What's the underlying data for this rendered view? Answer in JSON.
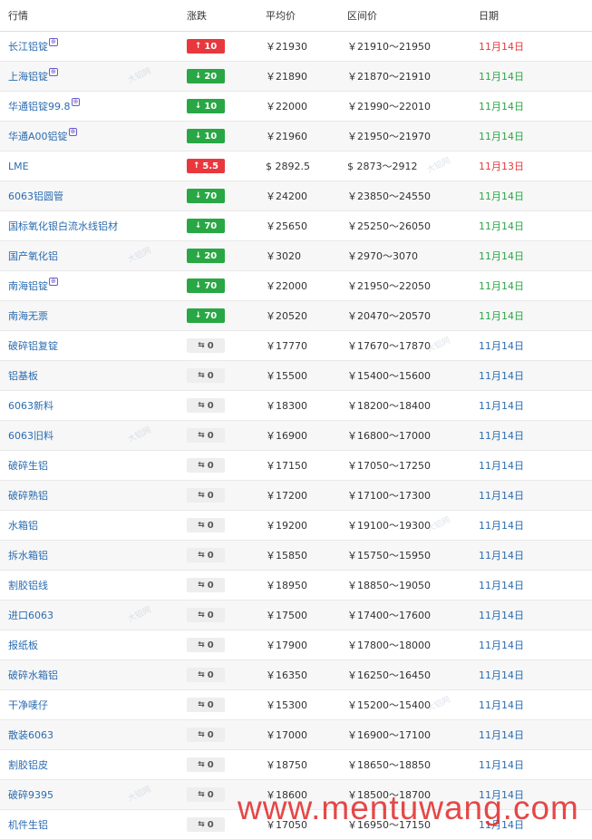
{
  "header": {
    "name": "行情",
    "change": "涨跌",
    "avg": "平均价",
    "range": "区间价",
    "date": "日期"
  },
  "rows": [
    {
      "name": "长江铝锭",
      "sup": "⊕",
      "dir": "up",
      "arrow": "↑",
      "change": "10",
      "avg": "￥21930",
      "range": "￥21910～21950",
      "date": "11月14日",
      "date_color": "red"
    },
    {
      "name": "上海铝锭",
      "sup": "⊕",
      "dir": "down",
      "arrow": "↓",
      "change": "20",
      "avg": "￥21890",
      "range": "￥21870～21910",
      "date": "11月14日",
      "date_color": "green"
    },
    {
      "name": "华通铝锭99.8",
      "sup": "⊕",
      "dir": "down",
      "arrow": "↓",
      "change": "10",
      "avg": "￥22000",
      "range": "￥21990～22010",
      "date": "11月14日",
      "date_color": "green"
    },
    {
      "name": "华通A00铝锭",
      "sup": "⊕",
      "dir": "down",
      "arrow": "↓",
      "change": "10",
      "avg": "￥21960",
      "range": "￥21950～21970",
      "date": "11月14日",
      "date_color": "green"
    },
    {
      "name": "LME",
      "sup": "",
      "dir": "up",
      "arrow": "↑",
      "change": "5.5",
      "avg": "$ 2892.5",
      "range": "$ 2873～2912",
      "date": "11月13日",
      "date_color": "red"
    },
    {
      "name": "6063铝圆管",
      "sup": "",
      "dir": "down",
      "arrow": "↓",
      "change": "70",
      "avg": "￥24200",
      "range": "￥23850～24550",
      "date": "11月14日",
      "date_color": "green"
    },
    {
      "name": "国标氧化银白流水线铝材",
      "sup": "",
      "dir": "down",
      "arrow": "↓",
      "change": "70",
      "avg": "￥25650",
      "range": "￥25250～26050",
      "date": "11月14日",
      "date_color": "green"
    },
    {
      "name": "国产氧化铝",
      "sup": "",
      "dir": "down",
      "arrow": "↓",
      "change": "20",
      "avg": "￥3020",
      "range": "￥2970～3070",
      "date": "11月14日",
      "date_color": "green"
    },
    {
      "name": "南海铝锭",
      "sup": "⊕",
      "dir": "down",
      "arrow": "↓",
      "change": "70",
      "avg": "￥22000",
      "range": "￥21950～22050",
      "date": "11月14日",
      "date_color": "green"
    },
    {
      "name": "南海无票",
      "sup": "",
      "dir": "down",
      "arrow": "↓",
      "change": "70",
      "avg": "￥20520",
      "range": "￥20470～20570",
      "date": "11月14日",
      "date_color": "green"
    },
    {
      "name": "破碎铝复锭",
      "sup": "",
      "dir": "flat",
      "arrow": "⇆",
      "change": "0",
      "avg": "￥17770",
      "range": "￥17670～17870",
      "date": "11月14日",
      "date_color": "blue"
    },
    {
      "name": "铝基板",
      "sup": "",
      "dir": "flat",
      "arrow": "⇆",
      "change": "0",
      "avg": "￥15500",
      "range": "￥15400～15600",
      "date": "11月14日",
      "date_color": "blue"
    },
    {
      "name": "6063新料",
      "sup": "",
      "dir": "flat",
      "arrow": "⇆",
      "change": "0",
      "avg": "￥18300",
      "range": "￥18200～18400",
      "date": "11月14日",
      "date_color": "blue"
    },
    {
      "name": "6063旧料",
      "sup": "",
      "dir": "flat",
      "arrow": "⇆",
      "change": "0",
      "avg": "￥16900",
      "range": "￥16800～17000",
      "date": "11月14日",
      "date_color": "blue"
    },
    {
      "name": "破碎生铝",
      "sup": "",
      "dir": "flat",
      "arrow": "⇆",
      "change": "0",
      "avg": "￥17150",
      "range": "￥17050～17250",
      "date": "11月14日",
      "date_color": "blue"
    },
    {
      "name": "破碎熟铝",
      "sup": "",
      "dir": "flat",
      "arrow": "⇆",
      "change": "0",
      "avg": "￥17200",
      "range": "￥17100～17300",
      "date": "11月14日",
      "date_color": "blue"
    },
    {
      "name": "水箱铝",
      "sup": "",
      "dir": "flat",
      "arrow": "⇆",
      "change": "0",
      "avg": "￥19200",
      "range": "￥19100～19300",
      "date": "11月14日",
      "date_color": "blue"
    },
    {
      "name": "拆水箱铝",
      "sup": "",
      "dir": "flat",
      "arrow": "⇆",
      "change": "0",
      "avg": "￥15850",
      "range": "￥15750～15950",
      "date": "11月14日",
      "date_color": "blue"
    },
    {
      "name": "割胶铝线",
      "sup": "",
      "dir": "flat",
      "arrow": "⇆",
      "change": "0",
      "avg": "￥18950",
      "range": "￥18850～19050",
      "date": "11月14日",
      "date_color": "blue"
    },
    {
      "name": "进口6063",
      "sup": "",
      "dir": "flat",
      "arrow": "⇆",
      "change": "0",
      "avg": "￥17500",
      "range": "￥17400～17600",
      "date": "11月14日",
      "date_color": "blue"
    },
    {
      "name": "报纸板",
      "sup": "",
      "dir": "flat",
      "arrow": "⇆",
      "change": "0",
      "avg": "￥17900",
      "range": "￥17800～18000",
      "date": "11月14日",
      "date_color": "blue"
    },
    {
      "name": "破碎水箱铝",
      "sup": "",
      "dir": "flat",
      "arrow": "⇆",
      "change": "0",
      "avg": "￥16350",
      "range": "￥16250～16450",
      "date": "11月14日",
      "date_color": "blue"
    },
    {
      "name": "干净唛仔",
      "sup": "",
      "dir": "flat",
      "arrow": "⇆",
      "change": "0",
      "avg": "￥15300",
      "range": "￥15200～15400",
      "date": "11月14日",
      "date_color": "blue"
    },
    {
      "name": "散装6063",
      "sup": "",
      "dir": "flat",
      "arrow": "⇆",
      "change": "0",
      "avg": "￥17000",
      "range": "￥16900～17100",
      "date": "11月14日",
      "date_color": "blue"
    },
    {
      "name": "割胶铝皮",
      "sup": "",
      "dir": "flat",
      "arrow": "⇆",
      "change": "0",
      "avg": "￥18750",
      "range": "￥18650～18850",
      "date": "11月14日",
      "date_color": "blue"
    },
    {
      "name": "破碎9395",
      "sup": "",
      "dir": "flat",
      "arrow": "⇆",
      "change": "0",
      "avg": "￥18600",
      "range": "￥18500～18700",
      "date": "11月14日",
      "date_color": "blue"
    },
    {
      "name": "机件生铝",
      "sup": "",
      "dir": "flat",
      "arrow": "⇆",
      "change": "0",
      "avg": "￥17050",
      "range": "￥16950～17150",
      "date": "11月14日",
      "date_color": "blue"
    }
  ],
  "watermark_logo": "大铝网",
  "site_watermark": "www.mentuwang.com"
}
